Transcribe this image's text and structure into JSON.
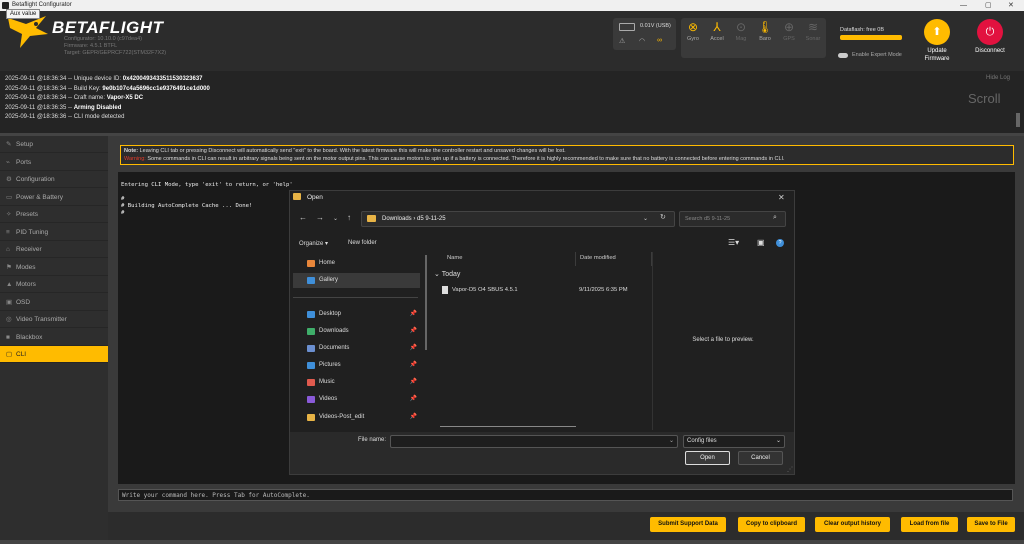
{
  "window": {
    "title": "Betaflight Configurator",
    "tooltip": "Aux value"
  },
  "header": {
    "brand": "BETAFLIGHT",
    "configurator": "Configurator: 10.10.0 (c97dea4)",
    "firmware": "Firmware: 4.5.1 BTFL",
    "target": "Target: GEPR/GEPRCF722(STM32F7X2)",
    "voltage": "0.01V (USB)",
    "sensors": [
      "Gyro",
      "Accel",
      "Mag",
      "Baro",
      "GPS",
      "Sonar"
    ],
    "dataflash": "Dataflash: free 0B",
    "expert_mode": "Enable Expert Mode",
    "update_firmware": "Update Firmware",
    "disconnect": "Disconnect",
    "colors": {
      "accent": "#ffbb00",
      "disconnect": "#e2123f"
    }
  },
  "log": {
    "lines": [
      {
        "ts": "2025-09-11 @18:36:34",
        "label": "Unique device ID:",
        "value": "0x4200493433511530323637"
      },
      {
        "ts": "2025-09-11 @18:36:34",
        "label": "Build Key:",
        "value": "9e0b107c4a5696cc1e9376491ce1d000"
      },
      {
        "ts": "2025-09-11 @18:36:34",
        "label": "Craft name:",
        "value": "Vapor-X5 DC"
      },
      {
        "ts": "2025-09-11 @18:36:35",
        "label": "",
        "value": "Arming Disabled"
      },
      {
        "ts": "2025-09-11 @18:36:36",
        "label": "CLI mode detected",
        "value": ""
      }
    ],
    "hide_log": "Hide Log",
    "scroll": "Scroll"
  },
  "sidebar": {
    "items": [
      {
        "label": "Setup",
        "icon": "wrench-icon",
        "glyph": "✎"
      },
      {
        "label": "Ports",
        "icon": "plug-icon",
        "glyph": "⌁"
      },
      {
        "label": "Configuration",
        "icon": "gear-icon",
        "glyph": "⚙"
      },
      {
        "label": "Power & Battery",
        "icon": "battery-icon",
        "glyph": "▭"
      },
      {
        "label": "Presets",
        "icon": "presets-icon",
        "glyph": "✧"
      },
      {
        "label": "PID Tuning",
        "icon": "sliders-icon",
        "glyph": "≡"
      },
      {
        "label": "Receiver",
        "icon": "receiver-icon",
        "glyph": "⌂"
      },
      {
        "label": "Modes",
        "icon": "modes-icon",
        "glyph": "⚑"
      },
      {
        "label": "Motors",
        "icon": "motor-icon",
        "glyph": "▲"
      },
      {
        "label": "OSD",
        "icon": "osd-icon",
        "glyph": "▣"
      },
      {
        "label": "Video Transmitter",
        "icon": "vtx-icon",
        "glyph": "◎"
      },
      {
        "label": "Blackbox",
        "icon": "blackbox-icon",
        "glyph": "■"
      },
      {
        "label": "CLI",
        "icon": "cli-icon",
        "glyph": "▢",
        "active": true
      }
    ]
  },
  "note": {
    "note_label": "Note:",
    "note_text": "Leaving CLI tab or pressing Disconnect will automatically send \"exit\" to the board. With the latest firmware this will make the controller restart and unsaved changes will be lost.",
    "warning_label": "Warning:",
    "warning_text": "Some commands in CLI can result in arbitrary signals being sent on the motor output pins. This can cause motors to spin up if a battery is connected. Therefore it is highly recommended to make sure that no battery is connected before entering commands in CLI."
  },
  "cli": {
    "output": "Entering CLI Mode, type 'exit' to return, or 'help'\n\n#\n# Building AutoComplete Cache ... Done!\n#",
    "input_placeholder": "Write your command here. Press Tab for AutoComplete."
  },
  "footer_buttons": [
    "Submit Support Data",
    "Copy to clipboard",
    "Clear output history",
    "Load from file",
    "Save to File"
  ],
  "dialog": {
    "title": "Open",
    "path": [
      "Downloads",
      "d5 9-11-25"
    ],
    "search_placeholder": "Search d5 9-11-25",
    "organize": "Organize",
    "new_folder": "New folder",
    "nav": [
      {
        "label": "Home",
        "color": "#e8863a",
        "pin": false
      },
      {
        "label": "Gallery",
        "color": "#3f8fd9",
        "pin": false,
        "selected": true
      },
      {
        "label": "Desktop",
        "color": "#3f8fd9",
        "pin": true
      },
      {
        "label": "Downloads",
        "color": "#3fae6a",
        "pin": true
      },
      {
        "label": "Documents",
        "color": "#6b8fd0",
        "pin": true
      },
      {
        "label": "Pictures",
        "color": "#3f8fd9",
        "pin": true
      },
      {
        "label": "Music",
        "color": "#e05a4e",
        "pin": true
      },
      {
        "label": "Videos",
        "color": "#8a5ad9",
        "pin": true
      },
      {
        "label": "Videos-Post_edit",
        "color": "#e8b446",
        "pin": true
      }
    ],
    "columns": {
      "name": "Name",
      "date": "Date modified"
    },
    "group": "Today",
    "files": [
      {
        "name": "Vapor-D5 O4 SBUS 4.5.1",
        "date": "9/11/2025 6:35 PM"
      }
    ],
    "preview": "Select a file to preview.",
    "file_name_label": "File name:",
    "file_type": "Config files",
    "open": "Open",
    "cancel": "Cancel"
  }
}
